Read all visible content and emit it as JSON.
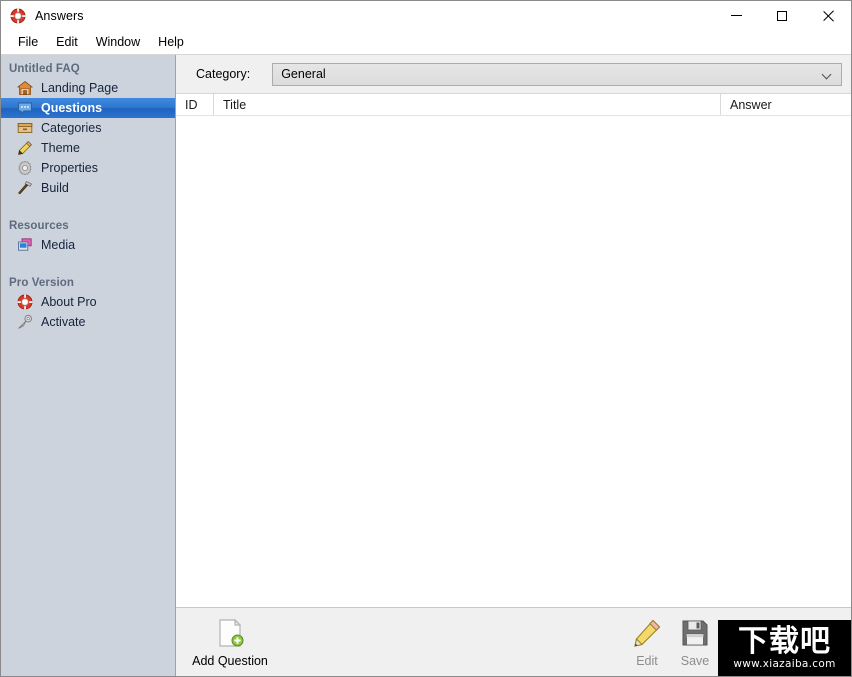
{
  "window": {
    "title": "Answers",
    "app_icon": "lifering-icon",
    "controls": {
      "minimize": "minimize-icon",
      "maximize": "maximize-icon",
      "close": "close-icon"
    }
  },
  "menubar": {
    "items": [
      {
        "label": "File"
      },
      {
        "label": "Edit"
      },
      {
        "label": "Window"
      },
      {
        "label": "Help"
      }
    ]
  },
  "sidebar": {
    "groups": [
      {
        "title": "Untitled FAQ",
        "items": [
          {
            "label": "Landing Page",
            "icon": "home-icon",
            "selected": false
          },
          {
            "label": "Questions",
            "icon": "speech-bubble-icon",
            "selected": true
          },
          {
            "label": "Categories",
            "icon": "drawer-box-icon",
            "selected": false
          },
          {
            "label": "Theme",
            "icon": "pencil-icon",
            "selected": false
          },
          {
            "label": "Properties",
            "icon": "gear-icon",
            "selected": false
          },
          {
            "label": "Build",
            "icon": "hammer-icon",
            "selected": false
          }
        ]
      },
      {
        "title": "Resources",
        "items": [
          {
            "label": "Media",
            "icon": "images-icon",
            "selected": false
          }
        ]
      },
      {
        "title": "Pro Version",
        "items": [
          {
            "label": "About Pro",
            "icon": "lifering-icon",
            "selected": false
          },
          {
            "label": "Activate",
            "icon": "key-icon",
            "selected": false
          }
        ]
      }
    ]
  },
  "main": {
    "category": {
      "label": "Category:",
      "selected": "General",
      "options": [
        "General"
      ],
      "chevron": "chevron-down-icon"
    },
    "table": {
      "columns": [
        "ID",
        "Title",
        "Answer"
      ],
      "rows": []
    }
  },
  "toolbar": {
    "buttons": [
      {
        "label": "Add Question",
        "icon": "new-document-icon",
        "disabled": false
      },
      {
        "label": "Edit",
        "icon": "pencil-icon",
        "disabled": true
      },
      {
        "label": "Save",
        "icon": "floppy-disk-icon",
        "disabled": true
      }
    ]
  },
  "watermark": {
    "main": "下载吧",
    "sub": "www.xiazaiba.com"
  },
  "colors": {
    "sidebar_bg": "#ccd3dd",
    "selection_blue": "#2f77d0",
    "toolbar_bg": "#f0f0f0",
    "group_title": "#5e6b7e"
  }
}
